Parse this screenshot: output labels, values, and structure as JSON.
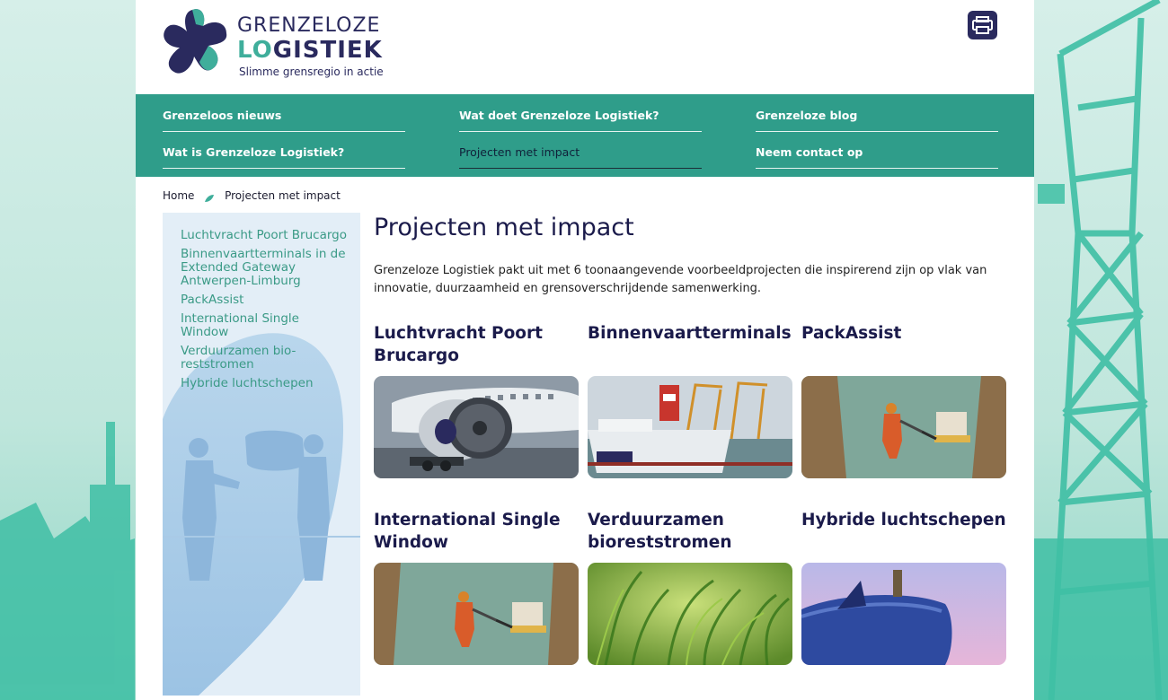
{
  "brand": {
    "name_top": "GRENZELOZE",
    "name_bottom_accent": "LO",
    "name_bottom_rest": "GISTIEK",
    "tagline": "Slimme grensregio in actie",
    "print_icon": "print-icon",
    "colors": {
      "navy": "#2a2a5e",
      "teal": "#2f9d8a",
      "accent": "#3fae9b",
      "link": "#3a9a86"
    }
  },
  "nav": {
    "items": [
      {
        "label": "Grenzeloos nieuws"
      },
      {
        "label": "Wat doet Grenzeloze Logistiek?"
      },
      {
        "label": "Grenzeloze blog"
      },
      {
        "label": "Wat is Grenzeloze Logistiek?"
      },
      {
        "label": "Projecten met impact",
        "active": true
      },
      {
        "label": "Neem contact op"
      }
    ]
  },
  "breadcrumb": {
    "home": "Home",
    "current": "Projecten met impact"
  },
  "sidebar": {
    "items": [
      {
        "label": "Luchtvracht Poort Brucargo"
      },
      {
        "label": "Binnenvaartterminals in de Extended Gateway Antwerpen-Limburg"
      },
      {
        "label": "PackAssist"
      },
      {
        "label": "International Single Window"
      },
      {
        "label": "Verduurzamen bio-reststromen"
      },
      {
        "label": "Hybride luchtschepen"
      }
    ]
  },
  "main": {
    "title": "Projecten met impact",
    "intro": "Grenzeloze Logistiek pakt uit met 6 toonaangevende voorbeeldprojecten die inspirerend zijn op vlak van innovatie, duurzaamheid en grensoverschrijdende samenwerking.",
    "projects": [
      {
        "title": "Luchtvracht Poort Brucargo",
        "image": "airplane-engine"
      },
      {
        "title": "Binnenvaartterminals",
        "image": "ship-harbour"
      },
      {
        "title": "PackAssist",
        "image": "worker-pallet"
      },
      {
        "title": "International Single Window",
        "image": "worker-pallet"
      },
      {
        "title": "Verduurzamen bioreststromen",
        "image": "grass"
      },
      {
        "title": "Hybride luchtschepen",
        "image": "airship"
      }
    ]
  }
}
